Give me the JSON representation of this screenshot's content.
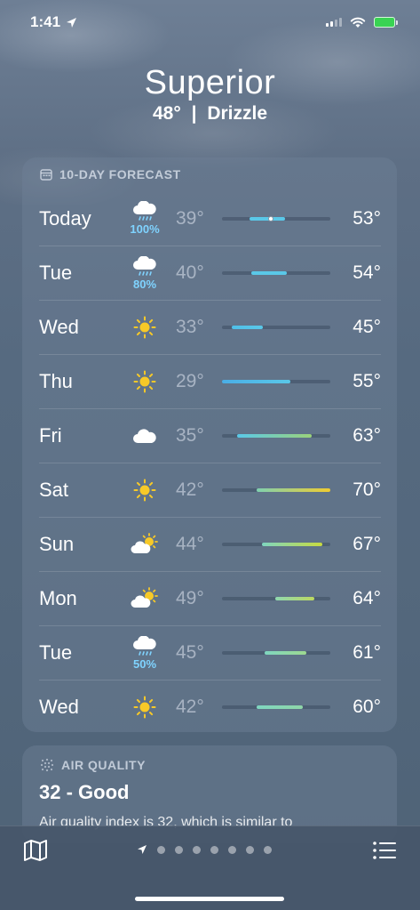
{
  "status_bar": {
    "time": "1:41"
  },
  "header": {
    "city": "Superior",
    "temp": "48°",
    "separator": "|",
    "condition": "Drizzle"
  },
  "forecast": {
    "title": "10-DAY FORECAST",
    "days": [
      {
        "day": "Today",
        "icon": "rain-cloud-icon",
        "precip": "100%",
        "low": "39°",
        "high": "53°",
        "bar_start": 0.25,
        "bar_end": 0.58,
        "colors": [
          "#5ac8e8",
          "#5ac8e8"
        ],
        "current": 0.45
      },
      {
        "day": "Tue",
        "icon": "rain-cloud-icon",
        "precip": "80%",
        "low": "40°",
        "high": "54°",
        "bar_start": 0.27,
        "bar_end": 0.6,
        "colors": [
          "#5ac8e8",
          "#5ac8e8"
        ]
      },
      {
        "day": "Wed",
        "icon": "sun-icon",
        "precip": "",
        "low": "33°",
        "high": "45°",
        "bar_start": 0.09,
        "bar_end": 0.38,
        "colors": [
          "#4fbfe8",
          "#5ac8e8"
        ]
      },
      {
        "day": "Thu",
        "icon": "sun-icon",
        "precip": "",
        "low": "29°",
        "high": "55°",
        "bar_start": 0.0,
        "bar_end": 0.63,
        "colors": [
          "#4aaee6",
          "#5ac8e8"
        ]
      },
      {
        "day": "Fri",
        "icon": "cloud-icon",
        "precip": "",
        "low": "35°",
        "high": "63°",
        "bar_start": 0.14,
        "bar_end": 0.83,
        "colors": [
          "#5ac8e8",
          "#9bd27a"
        ]
      },
      {
        "day": "Sat",
        "icon": "sun-icon",
        "precip": "",
        "low": "42°",
        "high": "70°",
        "bar_start": 0.32,
        "bar_end": 1.0,
        "colors": [
          "#7fd0b0",
          "#f0cc30"
        ]
      },
      {
        "day": "Sun",
        "icon": "partly-sunny-icon",
        "precip": "",
        "low": "44°",
        "high": "67°",
        "bar_start": 0.37,
        "bar_end": 0.93,
        "colors": [
          "#7fd6c0",
          "#c8da40"
        ]
      },
      {
        "day": "Mon",
        "icon": "partly-sunny-icon",
        "precip": "",
        "low": "49°",
        "high": "64°",
        "bar_start": 0.49,
        "bar_end": 0.85,
        "colors": [
          "#8fd8b0",
          "#bcd860"
        ]
      },
      {
        "day": "Tue",
        "icon": "rain-cloud-icon",
        "precip": "50%",
        "low": "45°",
        "high": "61°",
        "bar_start": 0.39,
        "bar_end": 0.78,
        "colors": [
          "#7fd6c0",
          "#9dd890"
        ]
      },
      {
        "day": "Wed",
        "icon": "sun-icon",
        "precip": "",
        "low": "42°",
        "high": "60°",
        "bar_start": 0.32,
        "bar_end": 0.75,
        "colors": [
          "#7fd6c0",
          "#8fd6a8"
        ]
      }
    ]
  },
  "air_quality": {
    "title": "AIR QUALITY",
    "value": "32 - Good",
    "description": "Air quality index is 32, which is similar to"
  },
  "bottom_bar": {
    "pages": 7,
    "current_page": 0
  }
}
